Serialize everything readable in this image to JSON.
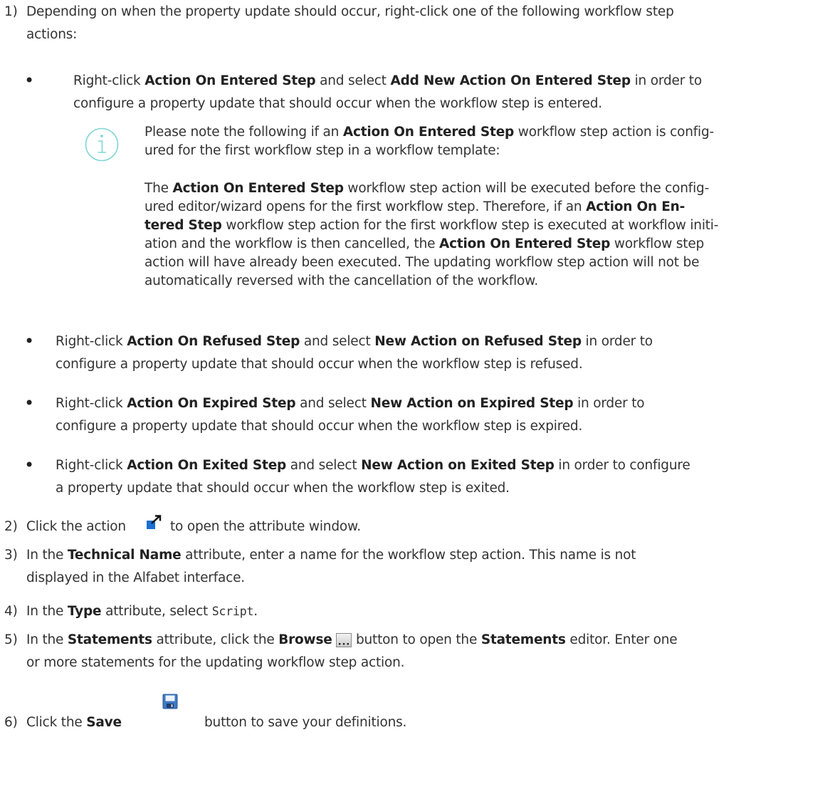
{
  "steps": {
    "s1": {
      "num": "1)",
      "l1": "Depending on when the property update should occur, right-click one of the following workflow step",
      "l2": "actions:"
    },
    "b1": {
      "a": "Right-click ",
      "b": "Action On Entered Step",
      "c": " and select ",
      "d": "Add New Action On Entered Step",
      "e": " in order to",
      "l2": "configure a property update that should occur when the workflow step is entered."
    },
    "note": {
      "l1a": "Please note the following if an ",
      "l1b": "Action On Entered Step",
      "l1c": " workflow step action is config-",
      "l2": "ured for the first workflow step in a workflow template:",
      "p2l1a": "The ",
      "p2l1b": "Action On Entered Step",
      "p2l1c": " workflow step action will be executed before the config-",
      "p2l2a": "ured editor/wizard opens for the first workflow step. Therefore, if an ",
      "p2l2b": "Action On En-",
      "p2l3a": "tered Step",
      "p2l3b": " workflow step action for the first workflow step is executed at workflow initi-",
      "p2l4a": "ation and the workflow is then cancelled, the ",
      "p2l4b": "Action On Entered Step",
      "p2l4c": " workflow step",
      "p2l5": "action will have already been executed. The updating workflow step action will not be",
      "p2l6": "automatically reversed with the cancellation of the workflow."
    },
    "b2": {
      "a": "Right-click ",
      "b": "Action On Refused Step",
      "c": " and select ",
      "d": "New Action on Refused Step",
      "e": " in order to",
      "l2": "configure a property update that should occur when the workflow step is refused."
    },
    "b3": {
      "a": "Right-click ",
      "b": "Action On Expired Step",
      "c": " and select ",
      "d": "New Action on Expired Step",
      "e": " in order to",
      "l2": "configure a property update that should occur when the workflow step is expired."
    },
    "b4": {
      "a": "Right-click ",
      "b": "Action On Exited Step",
      "c": " and select ",
      "d": "New Action on Exited Step",
      "e": " in order to configure",
      "l2": "a property update that should occur when the workflow step is exited."
    },
    "s2": {
      "num": "2)",
      "a": "Click the action",
      "b": "to open the attribute window."
    },
    "s3": {
      "num": "3)",
      "a": "In the ",
      "b": "Technical Name",
      "c": " attribute, enter a name for the workflow step action. This name is not",
      "l2": "displayed in the Alfabet interface."
    },
    "s4": {
      "num": "4)",
      "a": "In the ",
      "b": "Type",
      "c": " attribute, select ",
      "d": "Script",
      "e": "."
    },
    "s5": {
      "num": "5)",
      "a": "In the ",
      "b": "Statements",
      "c": " attribute, click the ",
      "d": "Browse",
      "e": " button to open the ",
      "f": "Statements",
      "g": " editor. Enter one",
      "l2": "or more statements for the updating workflow step action."
    },
    "s6": {
      "num": "6)",
      "a": "Click the ",
      "b": "Save",
      "c": "button to save your definitions."
    }
  },
  "bullet_glyph": "•",
  "icons": [
    "info-icon",
    "open-attribute-icon",
    "browse-icon",
    "save-icon"
  ],
  "colors": {
    "text": "#333333",
    "info_icon": "#7fd6d6",
    "icon_blue": "#1a6fd1"
  }
}
